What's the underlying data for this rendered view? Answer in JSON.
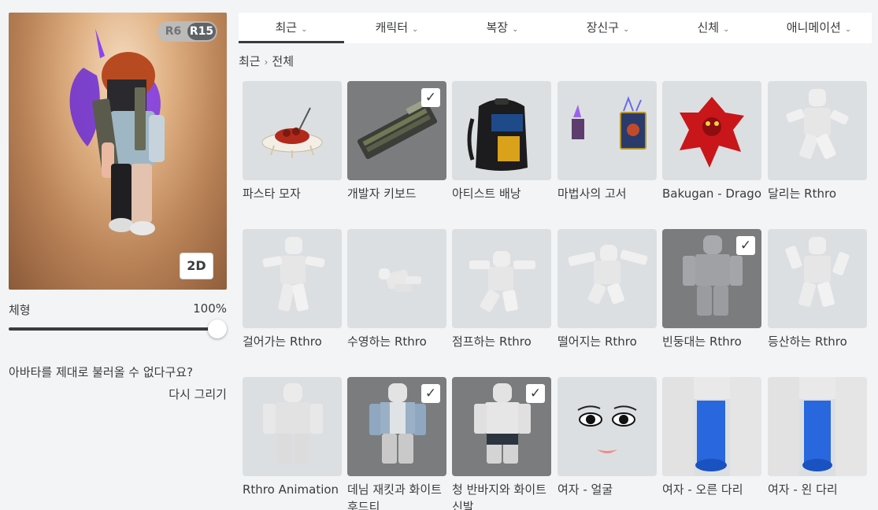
{
  "avatar": {
    "rig_options": [
      "R6",
      "R15"
    ],
    "rig_selected": "R15",
    "view_mode_label": "2D",
    "body_type_label": "체형",
    "body_type_value": "100%",
    "body_type_level": 1.0,
    "reload_message": "아바타를 제대로 불러올 수 없다구요?",
    "redraw_label": "다시 그리기"
  },
  "tabs": [
    {
      "label": "최근",
      "active": true
    },
    {
      "label": "캐릭터",
      "active": false
    },
    {
      "label": "복장",
      "active": false
    },
    {
      "label": "장신구",
      "active": false
    },
    {
      "label": "신체",
      "active": false
    },
    {
      "label": "애니메이션",
      "active": false
    }
  ],
  "breadcrumb": {
    "parent": "최근",
    "current": "전체"
  },
  "items": [
    {
      "name": "파스타 모자",
      "selected": false,
      "icon": "pasta-hat-icon"
    },
    {
      "name": "개발자 키보드",
      "selected": true,
      "icon": "keyboard-icon"
    },
    {
      "name": "아티스트 배낭",
      "selected": false,
      "icon": "backpack-icon"
    },
    {
      "name": "마법사의 고서",
      "selected": false,
      "icon": "spellbook-icon"
    },
    {
      "name": "Bakugan - Drago",
      "selected": false,
      "icon": "dragon-icon"
    },
    {
      "name": "달리는 Rthro",
      "selected": false,
      "icon": "running-figure-icon"
    },
    {
      "name": "걸어가는 Rthro",
      "selected": false,
      "icon": "walking-figure-icon"
    },
    {
      "name": "수영하는 Rthro",
      "selected": false,
      "icon": "swimming-figure-icon"
    },
    {
      "name": "점프하는 Rthro",
      "selected": false,
      "icon": "jumping-figure-icon"
    },
    {
      "name": "떨어지는 Rthro",
      "selected": false,
      "icon": "falling-figure-icon"
    },
    {
      "name": "빈둥대는 Rthro",
      "selected": true,
      "icon": "idle-figure-icon"
    },
    {
      "name": "등산하는 Rthro",
      "selected": false,
      "icon": "climbing-figure-icon"
    },
    {
      "name": "Rthro Animation",
      "selected": false,
      "icon": "standing-figure-icon"
    },
    {
      "name": "데님 재킷과 화이트 후드티",
      "selected": true,
      "icon": "denim-jacket-icon"
    },
    {
      "name": "청 반바지와 화이트 신발",
      "selected": true,
      "icon": "denim-shorts-icon"
    },
    {
      "name": "여자 - 얼굴",
      "selected": false,
      "icon": "face-icon"
    },
    {
      "name": "여자 - 오른 다리",
      "selected": false,
      "icon": "right-leg-icon"
    },
    {
      "name": "여자 - 왼 다리",
      "selected": false,
      "icon": "left-leg-icon"
    }
  ],
  "check_glyph": "✓",
  "breadcrumb_sep": "›",
  "tab_chevron": "⌄"
}
